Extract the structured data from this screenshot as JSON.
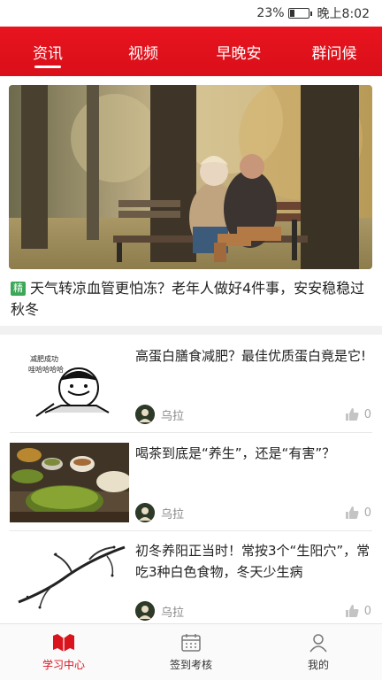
{
  "status_bar": {
    "battery": "23%",
    "time": "晚上8:02"
  },
  "top_tabs": [
    {
      "label": "资讯",
      "active": true
    },
    {
      "label": "视频",
      "active": false
    },
    {
      "label": "早晚安",
      "active": false
    },
    {
      "label": "群问候",
      "active": false
    }
  ],
  "featured": {
    "tag": "精",
    "title": "天气转凉血管更怕冻？老年人做好4件事，安安稳稳过秋冬"
  },
  "articles": [
    {
      "title": "高蛋白膳食减肥？最佳优质蛋白竟是它!",
      "author": "乌拉",
      "likes": "0",
      "thumb_caption": "减肥成功\n哇哈哈哈哈"
    },
    {
      "title": "喝茶到底是“养生”，还是“有害”？",
      "author": "乌拉",
      "likes": "0"
    },
    {
      "title": "初冬养阳正当时！常按3个“生阳穴”，常吃3种白色食物，冬天少生病",
      "author": "乌拉",
      "likes": "0"
    }
  ],
  "bottom_nav": [
    {
      "label": "学习中心",
      "icon": "book-icon",
      "active": true
    },
    {
      "label": "签到考核",
      "icon": "calendar-icon",
      "active": false
    },
    {
      "label": "我的",
      "icon": "user-icon",
      "active": false
    }
  ],
  "colors": {
    "brand_red": "#d9141d",
    "tag_green": "#3aa856"
  }
}
